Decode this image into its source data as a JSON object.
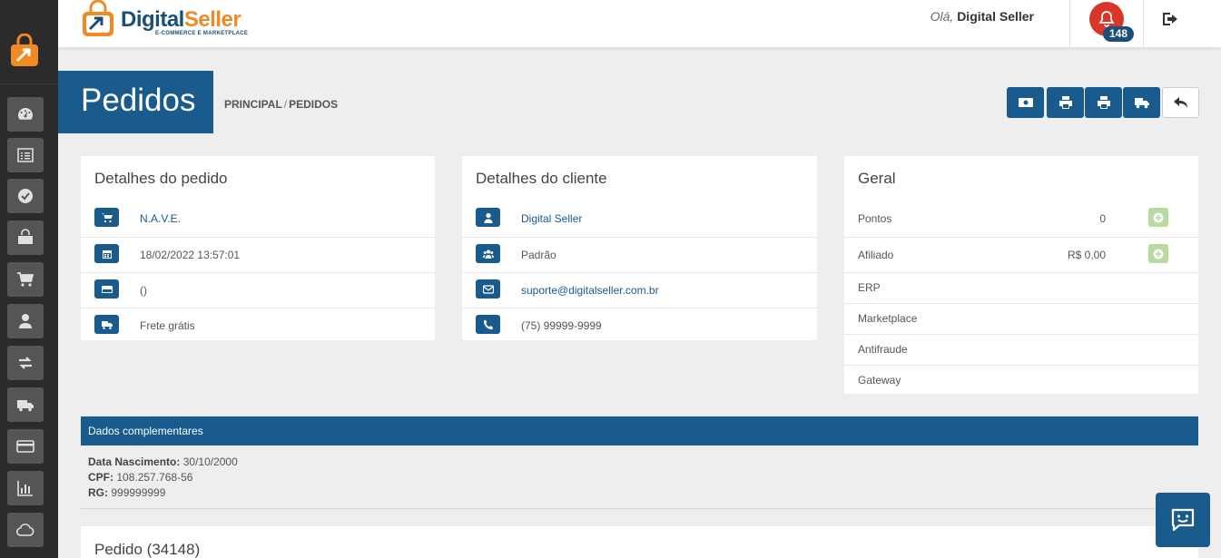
{
  "header": {
    "brand_name_part1": "Digital",
    "brand_name_part2": "Seller",
    "brand_tagline": "E-COMMERCE E MARKETPLACE",
    "greeting_prefix": "Olá,",
    "greeting_user": "Digital Seller",
    "notification_count": "148"
  },
  "sidebar": {
    "items": [
      {
        "icon": "dashboard-icon"
      },
      {
        "icon": "list-icon"
      },
      {
        "icon": "check-circle-icon"
      },
      {
        "icon": "shopping-bag-icon"
      },
      {
        "icon": "shopping-cart-icon"
      },
      {
        "icon": "user-icon"
      },
      {
        "icon": "exchange-icon"
      },
      {
        "icon": "truck-icon"
      },
      {
        "icon": "credit-card-icon"
      },
      {
        "icon": "bar-chart-icon"
      },
      {
        "icon": "cloud-icon"
      }
    ]
  },
  "page": {
    "title": "Pedidos",
    "breadcrumb_home": "PRINCIPAL",
    "breadcrumb_sep": "/",
    "breadcrumb_current": "PEDIDOS"
  },
  "order_details": {
    "title": "Detalhes do pedido",
    "store": "N.A.V.E.",
    "date": "18/02/2022 13:57:01",
    "payment": "()",
    "shipping": "Frete grátis"
  },
  "client_details": {
    "title": "Detalhes do cliente",
    "name": "Digital Seller",
    "group": "Padrão",
    "email": "suporte@digitalseller.com.br",
    "phone": "(75) 99999-9999"
  },
  "general": {
    "title": "Geral",
    "points_label": "Pontos",
    "points_value": "0",
    "affiliate_label": "Afiliado",
    "affiliate_value": "R$ 0,00",
    "erp_label": "ERP",
    "marketplace_label": "Marketplace",
    "antifraud_label": "Antifraude",
    "gateway_label": "Gateway"
  },
  "complementary": {
    "title": "Dados complementares",
    "birth_label": "Data Nascimento:",
    "birth_value": "30/10/2000",
    "cpf_label": "CPF:",
    "cpf_value": "108.257.768-56",
    "rg_label": "RG:",
    "rg_value": "999999999"
  },
  "order_section": {
    "title": "Pedido (34148)"
  },
  "colors": {
    "primary": "#1a5b8e",
    "accent": "#f08a24",
    "alert": "#d9352b",
    "sidebar": "#2b2b2b"
  }
}
